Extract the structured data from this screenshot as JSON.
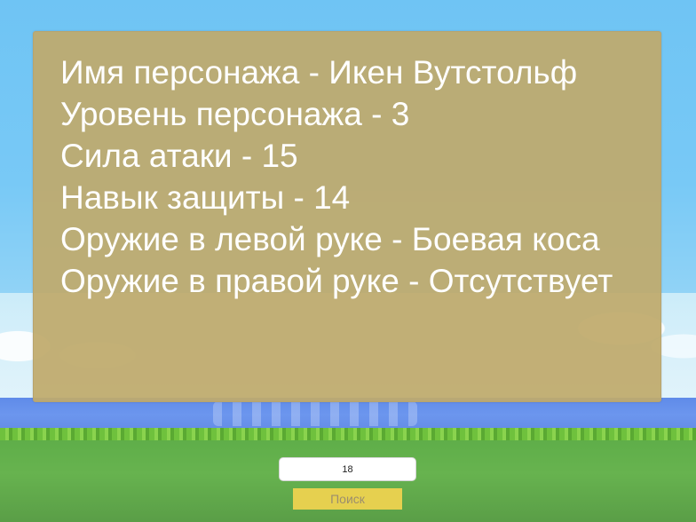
{
  "character_info": {
    "name_line": "Имя персонажа - Икен Вутстольф",
    "level_line": "Уровень персонажа - 3",
    "attack_line": "Сила атаки - 15",
    "defense_line": "Навык защиты - 14",
    "left_hand_line": "Оружие в левой руке - Боевая коса",
    "right_hand_line": "Оружие в правой руке - Отсутствует"
  },
  "search": {
    "input_value": "18",
    "button_label": "Поиск"
  },
  "colors": {
    "panel": "#c0aa6c",
    "panel_text": "#ffffff",
    "button": "#e6d04f",
    "button_text": "#9c8e6d",
    "sky": "#78c9f6",
    "sea": "#6c96ee",
    "grass": "#67b34f"
  }
}
